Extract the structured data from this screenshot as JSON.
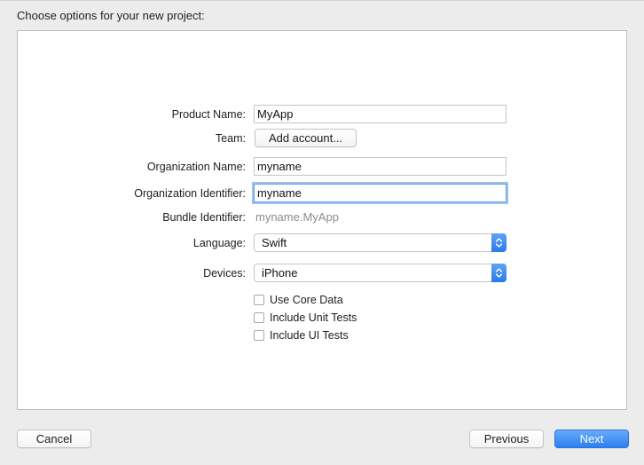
{
  "dialog": {
    "heading": "Choose options for your new project:"
  },
  "form": {
    "product_name": {
      "label": "Product Name:",
      "value": "MyApp"
    },
    "team": {
      "label": "Team:",
      "button_label": "Add account..."
    },
    "organization_name": {
      "label": "Organization Name:",
      "value": "myname"
    },
    "organization_identifier": {
      "label": "Organization Identifier:",
      "value": "myname"
    },
    "bundle_identifier": {
      "label": "Bundle Identifier:",
      "value": "myname.MyApp"
    },
    "language": {
      "label": "Language:",
      "selected": "Swift"
    },
    "devices": {
      "label": "Devices:",
      "selected": "iPhone"
    },
    "options": [
      {
        "label": "Use Core Data",
        "checked": false
      },
      {
        "label": "Include Unit Tests",
        "checked": false
      },
      {
        "label": "Include UI Tests",
        "checked": false
      }
    ]
  },
  "footer": {
    "cancel_label": "Cancel",
    "previous_label": "Previous",
    "next_label": "Next"
  },
  "colors": {
    "accent": "#2c7ff0",
    "focus_ring": "#9cc2f5",
    "window_bg": "#ececec"
  },
  "icons": {
    "popup_arrows": "chevron-up-down-icon"
  }
}
